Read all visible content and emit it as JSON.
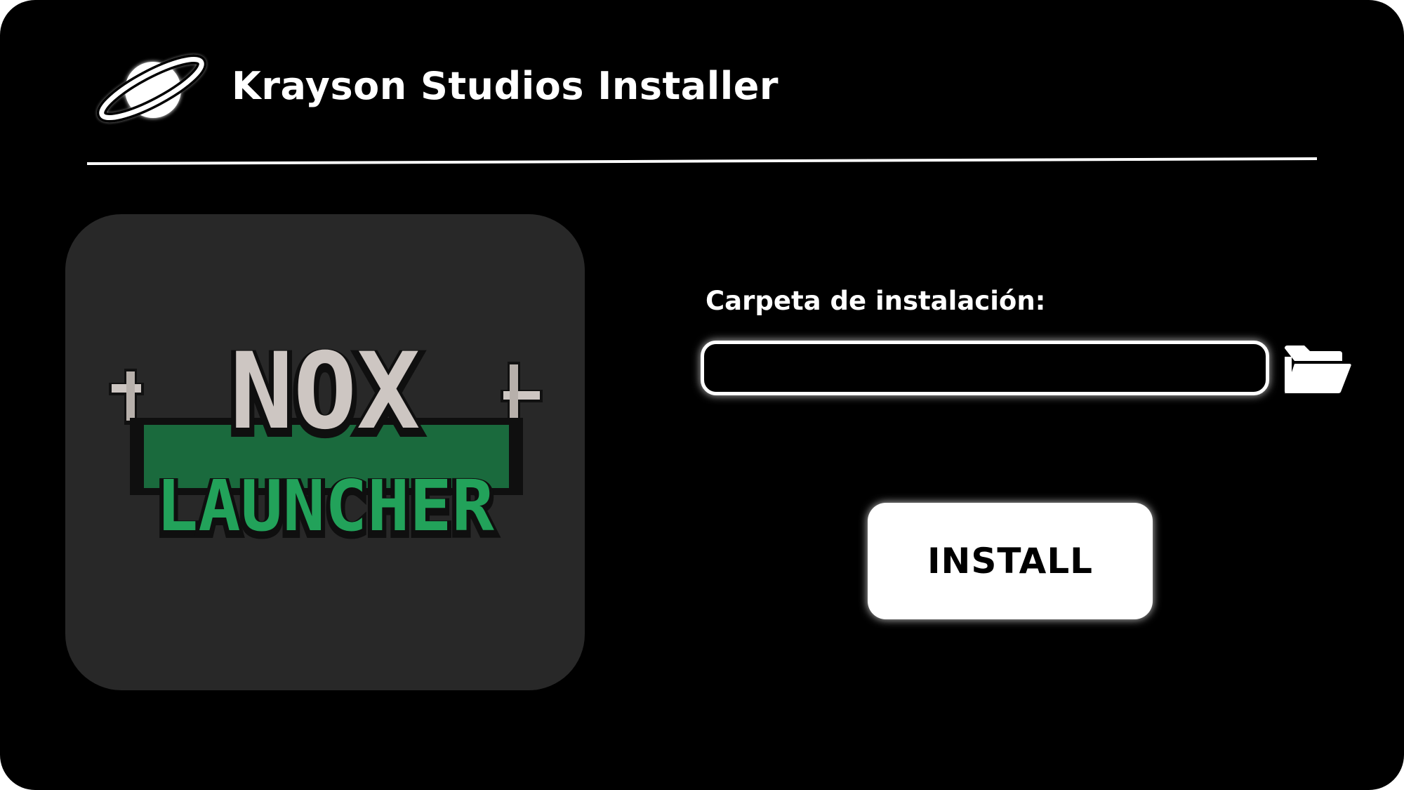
{
  "app": {
    "title": "Krayson Studios Installer",
    "logo_icon": "planet-icon"
  },
  "product": {
    "logo_line1": "NOX",
    "logo_line2": "LAUNCHER",
    "colors": {
      "top_text": "#cdc6c2",
      "bottom_text": "#1f8f4f"
    }
  },
  "install_folder": {
    "label": "Carpeta de instalación:",
    "value": "",
    "browse_icon": "folder-open-icon"
  },
  "actions": {
    "install_label": "INSTALL"
  },
  "theme": {
    "background": "#000000",
    "panel": "#282828",
    "accent": "#ffffff"
  }
}
